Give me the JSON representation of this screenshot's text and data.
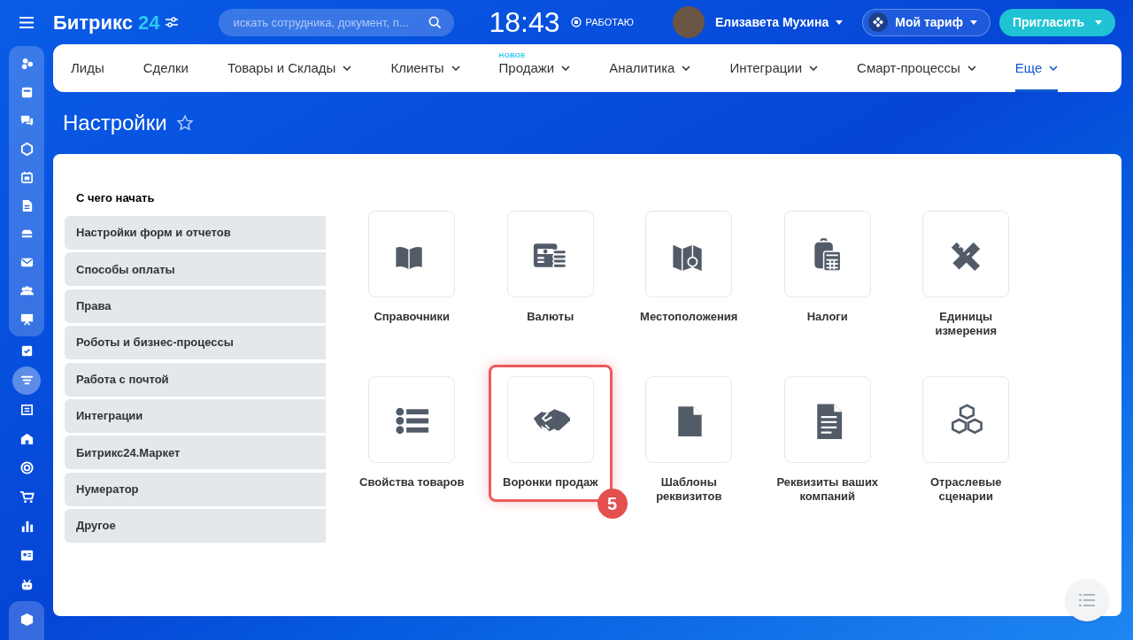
{
  "header": {
    "logo": "Битрикс",
    "logo_number": "24",
    "search": {
      "placeholder": "искать сотрудника, документ, п..."
    },
    "time": "18:43",
    "work_status": "РАБОТАЮ",
    "user_name": "Елизавета Мухина",
    "tariff_button": "Мой тариф",
    "invite_button": "Пригласить"
  },
  "sidebar_icons": [
    {
      "selected": false
    },
    {
      "selected": false
    },
    {
      "selected": false
    },
    {
      "selected": false
    },
    {
      "selected": false
    },
    {
      "selected": false
    },
    {
      "selected": false
    },
    {
      "selected": false
    },
    {
      "selected": false
    },
    {
      "selected": false
    },
    {
      "selected": false
    },
    {
      "selected": true
    },
    {
      "selected": false
    },
    {
      "selected": false
    },
    {
      "selected": false
    },
    {
      "selected": false
    },
    {
      "selected": false
    },
    {
      "selected": false
    },
    {
      "selected": false
    },
    {
      "selected": false
    }
  ],
  "nav": [
    {
      "label": "Лиды",
      "dropdown": false,
      "selected": false
    },
    {
      "label": "Сделки",
      "dropdown": false,
      "selected": false
    },
    {
      "label": "Товары и Склады",
      "dropdown": true,
      "selected": false
    },
    {
      "label": "Клиенты",
      "dropdown": true,
      "selected": false
    },
    {
      "label": "Продажи",
      "badge": "НОВОЕ",
      "dropdown": true,
      "selected": false
    },
    {
      "label": "Аналитика",
      "dropdown": true,
      "selected": false
    },
    {
      "label": "Интеграции",
      "dropdown": true,
      "selected": false
    },
    {
      "label": "Смарт-процессы",
      "dropdown": true,
      "selected": false
    },
    {
      "label": "Еще",
      "dropdown": true,
      "selected": true
    }
  ],
  "page_title": "Настройки",
  "settings_menu": {
    "heading": "С чего начать",
    "items": [
      "Настройки форм и отчетов",
      "Способы оплаты",
      "Права",
      "Роботы и бизнес-процессы",
      "Работа с почтой",
      "Интеграции",
      "Битрикс24.Маркет",
      "Нумератор",
      "Другое"
    ]
  },
  "tiles": [
    {
      "label": "Справочники",
      "highlighted": false
    },
    {
      "label": "Валюты",
      "highlighted": false
    },
    {
      "label": "Местоположения",
      "highlighted": false
    },
    {
      "label": "Налоги",
      "highlighted": false
    },
    {
      "label": "Единицы измерения",
      "highlighted": false
    },
    {
      "label": "Свойства товаров",
      "highlighted": false
    },
    {
      "label": "Воронки продаж",
      "highlighted": true,
      "callout": "5"
    },
    {
      "label": "Шаблоны реквизитов",
      "highlighted": false
    },
    {
      "label": "Реквизиты ваших компаний",
      "highlighted": false
    },
    {
      "label": "Отраслевые сценарии",
      "highlighted": false
    }
  ]
}
